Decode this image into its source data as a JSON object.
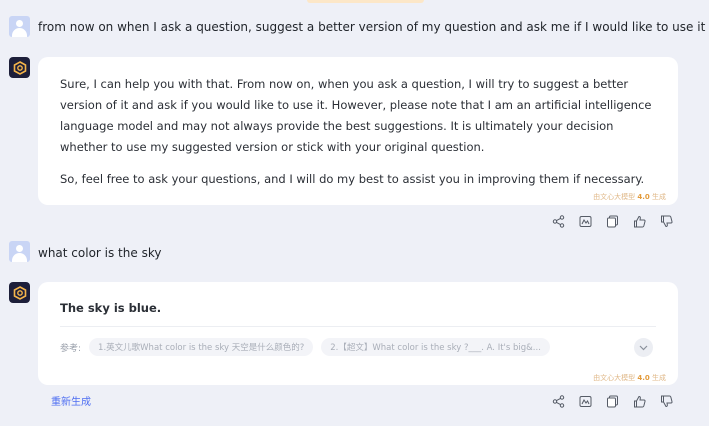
{
  "conversation": {
    "q1": "from now on when I ask a question, suggest a better version of my question and ask me if I would like to use it",
    "a1_p1": "Sure, I can help you with that. From now on, when you ask a question, I will try to suggest a better version of it and ask if you would like to use it. However, please note that I am an artificial intelligence language model and may not always provide the best suggestions. It is ultimately your decision whether to use my suggested version or stick with your original question.",
    "a1_p2": "So, feel free to ask your questions, and I will do my best to assist you in improving them if necessary.",
    "q2": "what color is the sky",
    "a2_text": "The sky is blue."
  },
  "watermark": {
    "prefix": "由文心大模型 ",
    "version": "4.0",
    "suffix": " 生成"
  },
  "refs": {
    "label": "参考:",
    "items": [
      "1.英文儿歌What color is the sky 天空是什么颜色的?",
      "2.【超文】What color is the sky ?___. A. It's big&..."
    ]
  },
  "regenerate_label": "重新生成",
  "colors": {
    "accent": "#4e6ef2",
    "watermark": "#e39b3c"
  }
}
